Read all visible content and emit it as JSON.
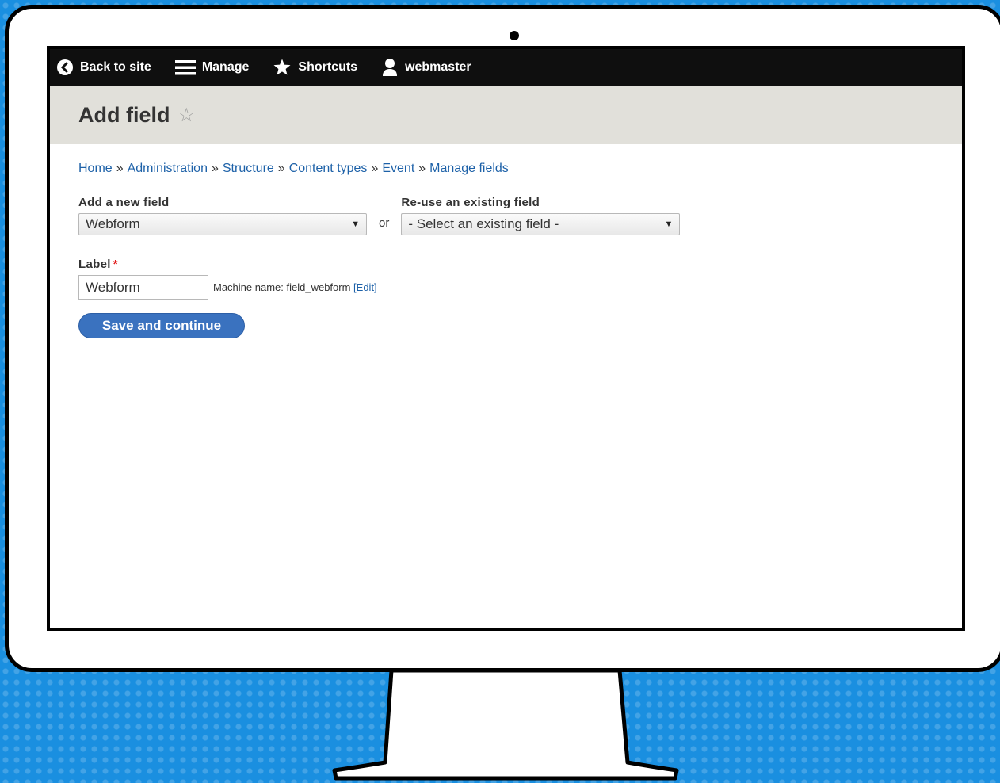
{
  "toolbar": {
    "back_label": "Back to site",
    "manage_label": "Manage",
    "shortcuts_label": "Shortcuts",
    "user_label": "webmaster"
  },
  "header": {
    "title": "Add field"
  },
  "breadcrumb": {
    "items": [
      "Home",
      "Administration",
      "Structure",
      "Content types",
      "Event",
      "Manage fields"
    ],
    "separator": "»"
  },
  "form": {
    "new_field_label": "Add a new field",
    "new_field_value": "Webform",
    "or_text": "or",
    "existing_field_label": "Re-use an existing field",
    "existing_field_value": "- Select an existing field -",
    "label_label": "Label",
    "required_mark": "*",
    "label_value": "Webform",
    "machine_name_text": "Machine name: field_webform",
    "edit_link": "[Edit]",
    "save_button": "Save and continue"
  },
  "colors": {
    "toolbar_bg": "#0f0f0f",
    "header_bg": "#e1e0da",
    "link": "#1d61a8",
    "primary_button": "#3a72bf",
    "required": "#e21a1a",
    "background": "#1a8fe0"
  }
}
